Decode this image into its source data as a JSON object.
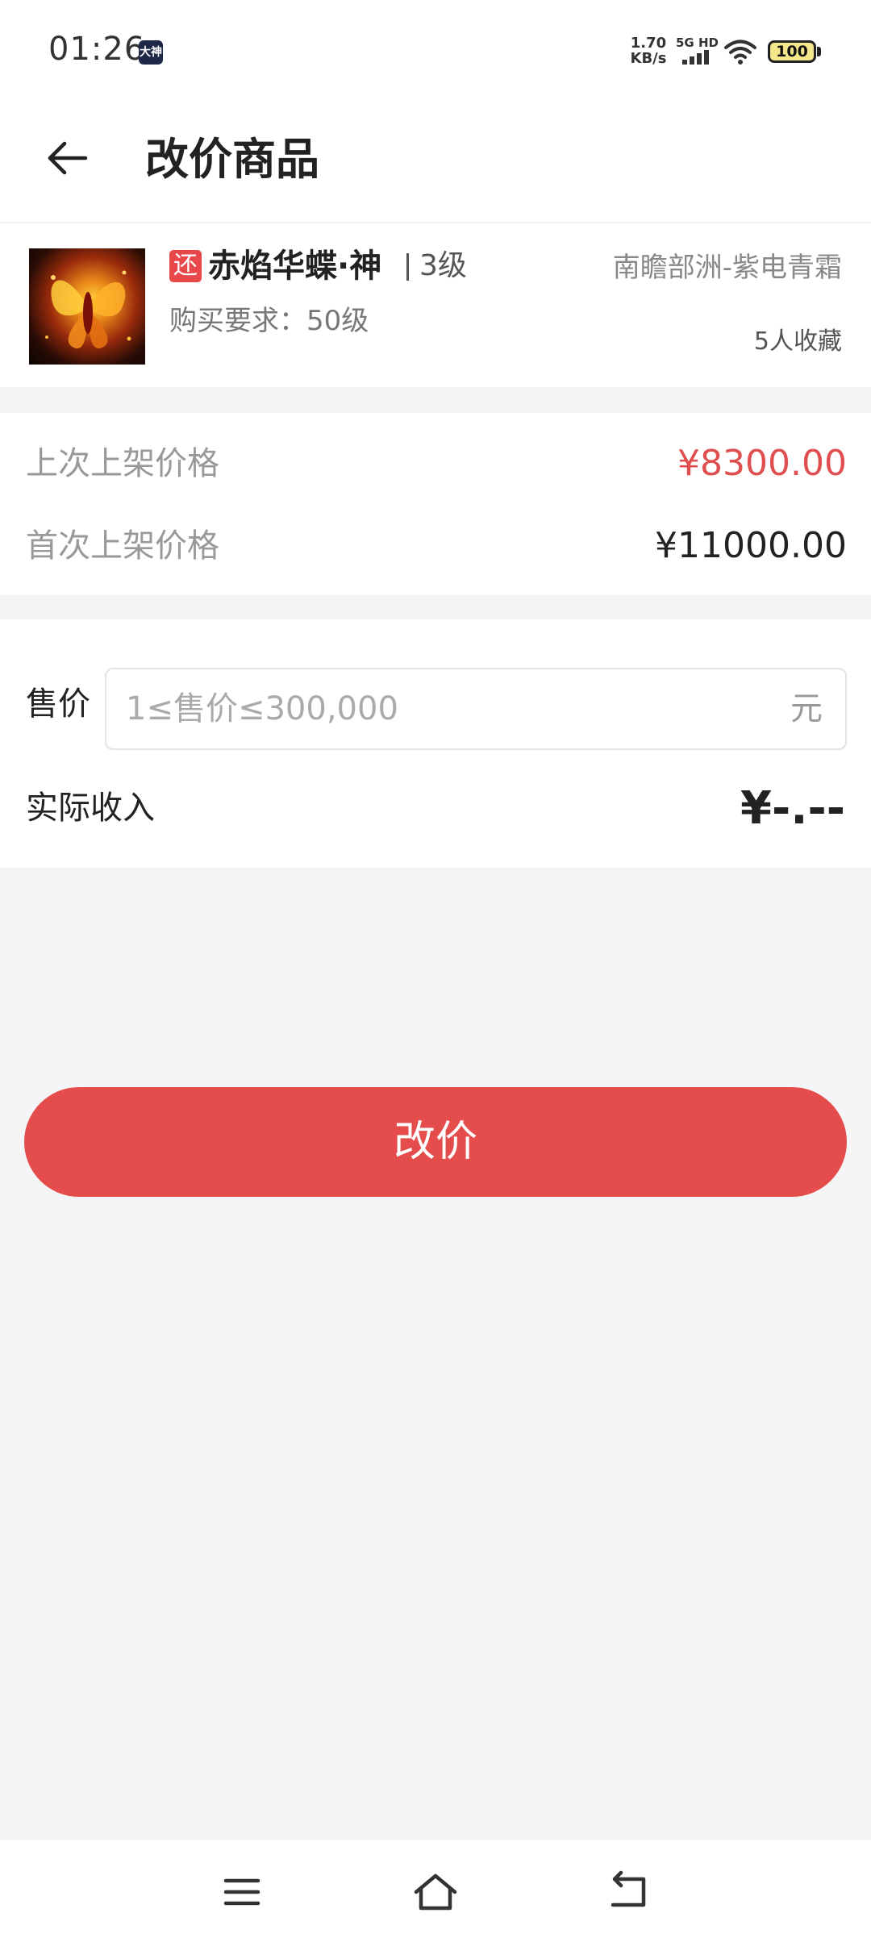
{
  "status_bar": {
    "time": "01:26",
    "app_badge": "大神",
    "net_speed_value": "1.70",
    "net_speed_unit": "KB/s",
    "signal_label": "5G HD",
    "battery": "100"
  },
  "header": {
    "title": "改价商品",
    "back_icon": "arrow-left-icon"
  },
  "product": {
    "tag": "还",
    "name": "赤焰华蝶·神",
    "level": "3级",
    "server": "南瞻部洲-紫电青霜",
    "buy_requirement": "购买要求：50级",
    "favorites": "5人收藏"
  },
  "price_history": {
    "last_label": "上次上架价格",
    "last_value": "¥8300.00",
    "last_color": "#e04f4f",
    "first_label": "首次上架价格",
    "first_value": "¥11000.00"
  },
  "form": {
    "price_label": "售价",
    "price_value": "",
    "price_placeholder": "1≤售价≤300,000",
    "price_unit": "元",
    "income_label": "实际收入",
    "income_value": "¥-.--"
  },
  "actions": {
    "submit_label": "改价",
    "submit_color": "#e54c4c"
  },
  "nav": {
    "menu_icon": "menu-icon",
    "home_icon": "home-icon",
    "back_icon": "back-return-icon"
  }
}
